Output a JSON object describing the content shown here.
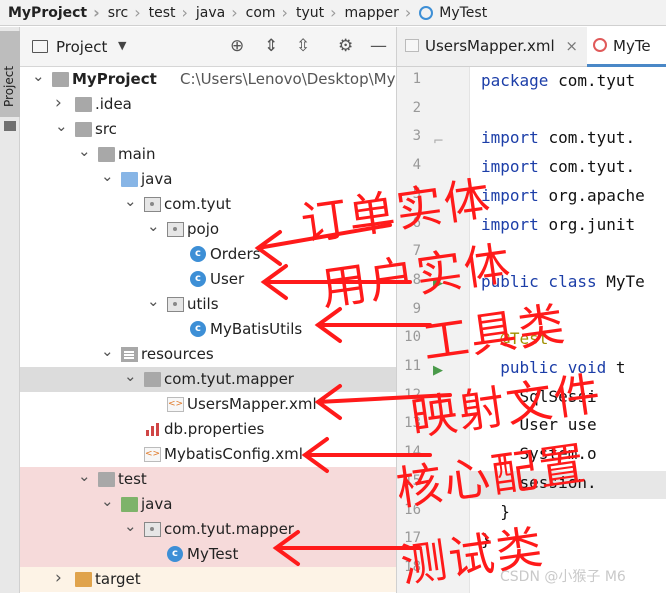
{
  "breadcrumb": [
    "MyProject",
    "src",
    "test",
    "java",
    "com",
    "tyut",
    "mapper",
    "MyTest"
  ],
  "side_tab": "Project",
  "project_panel": {
    "title": "Project",
    "toolbar_icons": [
      "target-icon",
      "expand-all-icon",
      "collapse-all-icon",
      "gear-icon",
      "minus-icon"
    ]
  },
  "tree": [
    {
      "label": "MyProject",
      "path": "C:\\Users\\Lenovo\\Desktop\\MyPro",
      "icon": "folder",
      "depth": 0,
      "arrow": "open",
      "bold": true
    },
    {
      "label": ".idea",
      "icon": "folder",
      "depth": 1,
      "arrow": "closed"
    },
    {
      "label": "src",
      "icon": "folder",
      "depth": 1,
      "arrow": "open"
    },
    {
      "label": "main",
      "icon": "folder",
      "depth": 2,
      "arrow": "open"
    },
    {
      "label": "java",
      "icon": "folder-blue",
      "depth": 3,
      "arrow": "open"
    },
    {
      "label": "com.tyut",
      "icon": "package",
      "depth": 4,
      "arrow": "open"
    },
    {
      "label": "pojo",
      "icon": "package",
      "depth": 5,
      "arrow": "open"
    },
    {
      "label": "Orders",
      "icon": "class",
      "depth": 6,
      "arrow": ""
    },
    {
      "label": "User",
      "icon": "class",
      "depth": 6,
      "arrow": ""
    },
    {
      "label": "utils",
      "icon": "package",
      "depth": 5,
      "arrow": "open"
    },
    {
      "label": "MyBatisUtils",
      "icon": "class",
      "depth": 6,
      "arrow": ""
    },
    {
      "label": "resources",
      "icon": "resources",
      "depth": 3,
      "arrow": "open"
    },
    {
      "label": "com.tyut.mapper",
      "icon": "folder",
      "depth": 4,
      "arrow": "open",
      "selected": true
    },
    {
      "label": "UsersMapper.xml",
      "icon": "xml",
      "depth": 5,
      "arrow": ""
    },
    {
      "label": "db.properties",
      "icon": "properties",
      "depth": 4,
      "arrow": ""
    },
    {
      "label": "MybatisConfig.xml",
      "icon": "xml",
      "depth": 4,
      "arrow": ""
    },
    {
      "label": "test",
      "icon": "folder",
      "depth": 2,
      "arrow": "open",
      "test": true
    },
    {
      "label": "java",
      "icon": "folder-green",
      "depth": 3,
      "arrow": "open",
      "test": true
    },
    {
      "label": "com.tyut.mapper",
      "icon": "package",
      "depth": 4,
      "arrow": "open",
      "test": true
    },
    {
      "label": "MyTest",
      "icon": "class",
      "depth": 5,
      "arrow": "",
      "test": true
    },
    {
      "label": "target",
      "icon": "folder-orange",
      "depth": 1,
      "arrow": "closed",
      "target": true
    }
  ],
  "editor_tabs": [
    {
      "label": "UsersMapper.xml",
      "icon": "xml",
      "closable": "×"
    },
    {
      "label": "MyTe",
      "icon": "class",
      "active": true
    }
  ],
  "line_numbers": [
    "1",
    "2",
    "3",
    "4",
    "5",
    "6",
    "7",
    "8",
    "9",
    "10",
    "11",
    "12",
    "13",
    "14",
    "15",
    "16",
    "17",
    "18"
  ],
  "code_lines": [
    {
      "ln": 1,
      "parts": [
        [
          "kw",
          "package"
        ],
        [
          "",
          "com.tyut"
        ]
      ]
    },
    {
      "ln": 3,
      "parts": [
        [
          "kw",
          "import"
        ],
        [
          "",
          "com.tyut."
        ]
      ]
    },
    {
      "ln": 4,
      "parts": [
        [
          "kw",
          "import"
        ],
        [
          "",
          "com.tyut."
        ]
      ]
    },
    {
      "ln": 5,
      "parts": [
        [
          "kw",
          "import"
        ],
        [
          "",
          "org.apache"
        ]
      ]
    },
    {
      "ln": 6,
      "parts": [
        [
          "kw",
          "import"
        ],
        [
          "",
          "org.junit"
        ]
      ]
    },
    {
      "ln": 8,
      "parts": [
        [
          "kw",
          "public class"
        ],
        [
          "",
          "MyTe"
        ]
      ]
    },
    {
      "ln": 10,
      "parts": [
        [
          "ann",
          "  @Test"
        ]
      ]
    },
    {
      "ln": 11,
      "parts": [
        [
          "kw",
          "  public void"
        ],
        [
          "",
          "t"
        ]
      ]
    },
    {
      "ln": 12,
      "parts": [
        [
          "",
          "    SqlSessi"
        ]
      ]
    },
    {
      "ln": 13,
      "parts": [
        [
          "",
          "    User use"
        ]
      ]
    },
    {
      "ln": 14,
      "parts": [
        [
          "",
          "    System.o"
        ]
      ]
    },
    {
      "ln": 15,
      "parts": [
        [
          "",
          "    session."
        ]
      ]
    },
    {
      "ln": 16,
      "parts": [
        [
          "",
          "  }"
        ]
      ]
    },
    {
      "ln": 17,
      "parts": [
        [
          "",
          "}"
        ]
      ]
    }
  ],
  "annotations": [
    "订单实体",
    "用户实体",
    "工具类",
    "映射文件",
    "核心配置",
    "测试类"
  ],
  "annotation_color": "#ff1a1a",
  "watermark": "CSDN @小猴子 M6",
  "colors": {
    "selection": "#dcdcdc",
    "test_bg": "#f6dada",
    "target_bg": "#fdf3e6",
    "keyword": "#1c3ea8",
    "annotation": "#a09000",
    "tab_active": "#4a88c7"
  }
}
